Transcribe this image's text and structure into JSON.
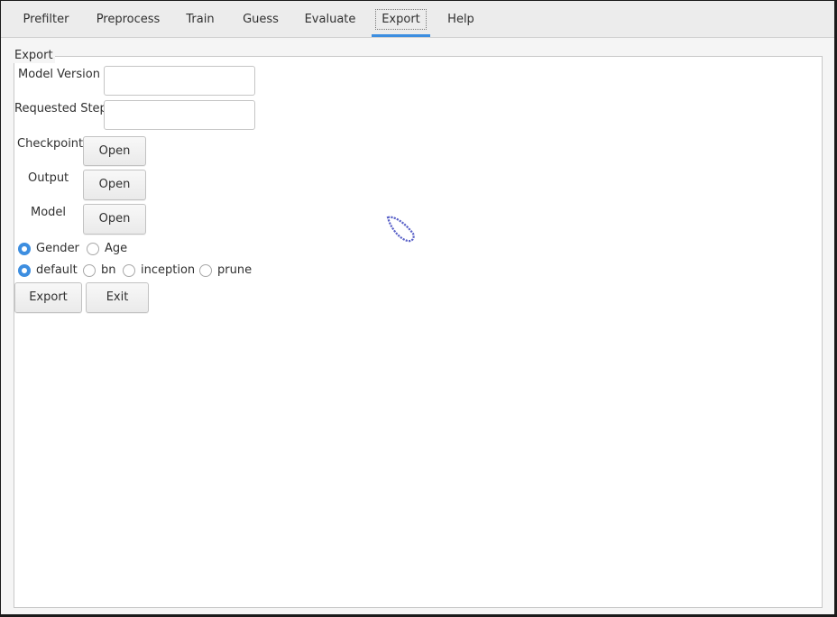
{
  "tabs": [
    {
      "label": "Prefilter"
    },
    {
      "label": "Preprocess"
    },
    {
      "label": "Train"
    },
    {
      "label": "Guess"
    },
    {
      "label": "Evaluate"
    },
    {
      "label": "Export",
      "active": true
    },
    {
      "label": "Help"
    }
  ],
  "export": {
    "group_title": "Export",
    "model_version": {
      "label": "Model Version",
      "value": ""
    },
    "requested_step": {
      "label": "Requested Step",
      "value": ""
    },
    "checkpoint": {
      "label": "Checkpoint",
      "button": "Open"
    },
    "output": {
      "label": "Output",
      "button": "Open"
    },
    "model": {
      "label": "Model",
      "button": "Open"
    },
    "target": {
      "options": [
        "Gender",
        "Age"
      ],
      "selected": "Gender"
    },
    "model_type": {
      "options": [
        "default",
        "bn",
        "inception",
        "prune"
      ],
      "selected": "default"
    },
    "export_button": "Export",
    "exit_button": "Exit"
  },
  "colors": {
    "accent": "#3d8ee0",
    "background": "#f5f5f5",
    "panel": "#ffffff"
  },
  "icons": {
    "cursor": "busy-cursor-icon"
  }
}
